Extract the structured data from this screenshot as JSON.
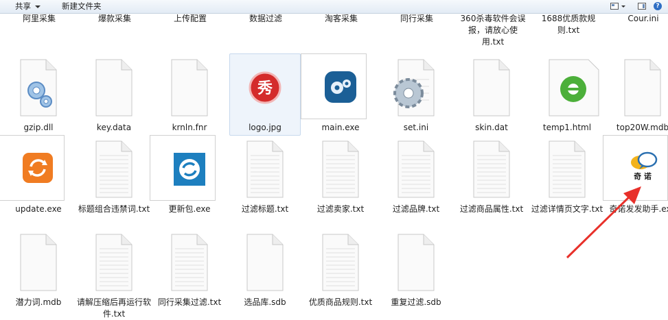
{
  "toolbar": {
    "share": "共享",
    "new_folder": "新建文件夹",
    "icons": [
      "view-options-icon",
      "preview-pane-icon",
      "help-icon"
    ]
  },
  "row0": [
    "阿里采集",
    "爆款采集",
    "上传配置",
    "数据过滤",
    "淘客采集",
    "同行采集",
    "360杀毒软件会误报，请放心使用.txt",
    "1688优质款规则.txt",
    "Cour.ini"
  ],
  "files": [
    {
      "name": "gzip.dll",
      "icon": "dll-gears-icon"
    },
    {
      "name": "key.data",
      "icon": "blank-file-icon"
    },
    {
      "name": "krnln.fnr",
      "icon": "blank-file-icon"
    },
    {
      "name": "logo.jpg",
      "icon": "xiu-logo-icon"
    },
    {
      "name": "main.exe",
      "icon": "main-app-icon"
    },
    {
      "name": "set.ini",
      "icon": "settings-gear-icon"
    },
    {
      "name": "skin.dat",
      "icon": "blank-file-icon"
    },
    {
      "name": "temp1.html",
      "icon": "ie-html-icon"
    },
    {
      "name": "top20W.mdb",
      "icon": "blank-file-icon"
    },
    {
      "name": "update.exe",
      "icon": "update-refresh-icon"
    },
    {
      "name": "标题组合违禁词.txt",
      "icon": "text-file-icon"
    },
    {
      "name": "更新包.exe",
      "icon": "update-package-icon"
    },
    {
      "name": "过滤标题.txt",
      "icon": "text-file-icon"
    },
    {
      "name": "过滤卖家.txt",
      "icon": "text-file-icon"
    },
    {
      "name": "过滤品牌.txt",
      "icon": "text-file-icon"
    },
    {
      "name": "过滤商品属性.txt",
      "icon": "text-file-icon"
    },
    {
      "name": "过滤详情页文字.txt",
      "icon": "text-file-icon"
    },
    {
      "name": "奇诺发发助手.exe",
      "icon": "qinuo-chat-icon",
      "logo_text": "奇 诺"
    },
    {
      "name": "潜力词.mdb",
      "icon": "blank-file-icon"
    },
    {
      "name": "请解压缩后再运行软件.txt",
      "icon": "text-file-icon"
    },
    {
      "name": "同行采集过滤.txt",
      "icon": "text-file-icon"
    },
    {
      "name": "选品库.sdb",
      "icon": "blank-file-icon"
    },
    {
      "name": "优质商品规则.txt",
      "icon": "text-file-icon"
    },
    {
      "name": "重复过滤.sdb",
      "icon": "blank-file-icon"
    }
  ],
  "colors": {
    "selection_border": "#c6d8ed",
    "annotation_arrow": "#e8302a",
    "toolbar_top": "#f6f9fc",
    "toolbar_bottom": "#e3ebf5"
  }
}
